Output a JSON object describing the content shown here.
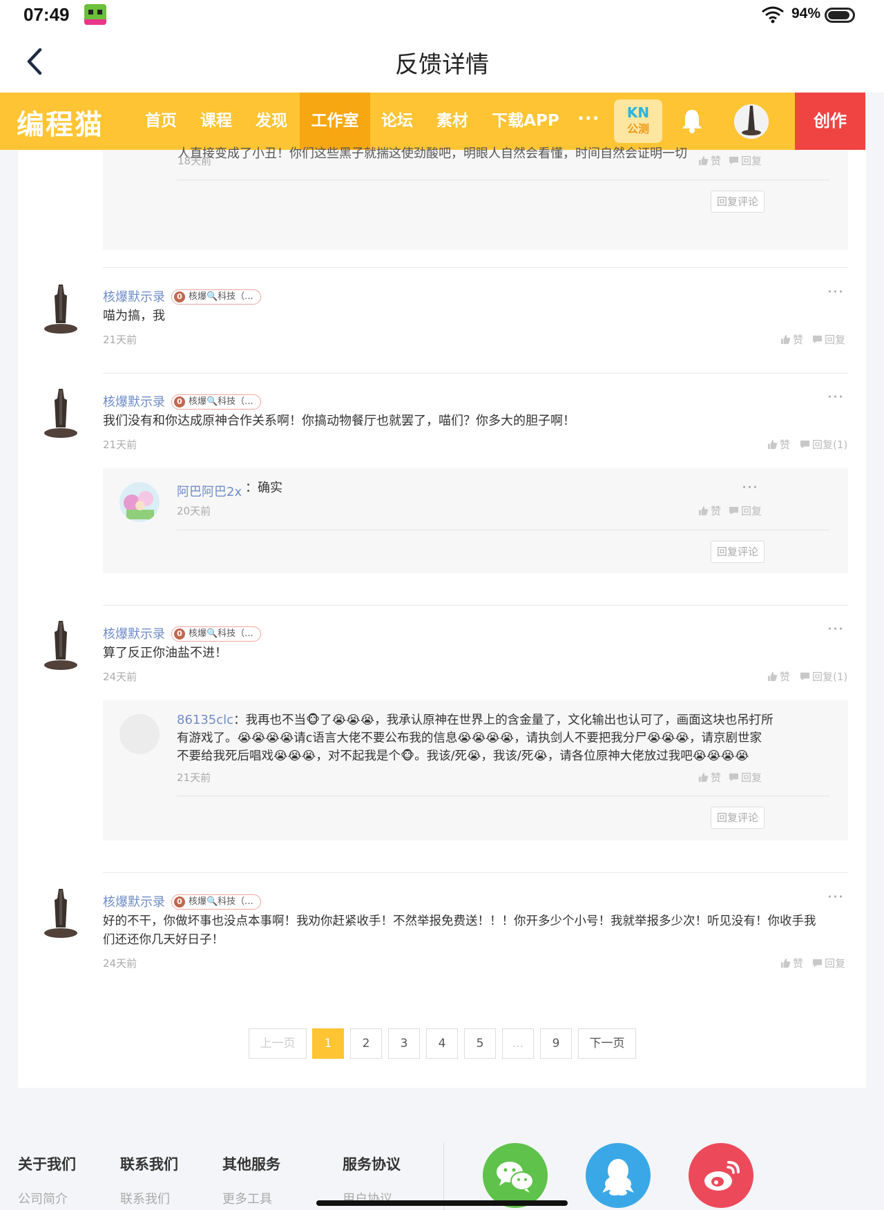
{
  "status_bar": {
    "time": "07:49",
    "battery": "94%"
  },
  "title_bar": {
    "title": "反馈详情"
  },
  "site_nav": {
    "logo": "编程猫",
    "items": [
      "首页",
      "课程",
      "发现",
      "工作室",
      "论坛",
      "素材",
      "下载APP"
    ],
    "active_item": "工作室",
    "more": "···",
    "kn_top": "KN",
    "kn_bottom": "公测",
    "create": "创作"
  },
  "colors": {
    "nav_bg": "#fec433",
    "nav_active": "#f7a712",
    "create_bg": "#ef4442",
    "username": "#6f8cc8"
  },
  "top_partial": {
    "text": "人直接变成了小丑！你们这些黑子就揣这使劲酸吧，明眼人自然会看懂，时间自然会证明一切",
    "time": "18天前",
    "like": "赞",
    "reply": "回复",
    "reply_comment": "回复评论"
  },
  "comments": [
    {
      "user": "核爆默示录",
      "badge": "核爆🔍科技（...",
      "text": "喵为搞，我",
      "time": "21天前",
      "like": "赞",
      "reply": "回复"
    },
    {
      "user": "核爆默示录",
      "badge": "核爆🔍科技（...",
      "text": "我们没有和你达成原神合作关系啊！你搞动物餐厅也就罢了，喵们？你多大的胆子啊！",
      "time": "21天前",
      "like": "赞",
      "reply": "回复(1)",
      "sub_reply": {
        "user": "阿巴阿巴2x",
        "text": "：确实",
        "time": "20天前",
        "like": "赞",
        "reply": "回复",
        "reply_comment": "回复评论"
      }
    },
    {
      "user": "核爆默示录",
      "badge": "核爆🔍科技（...",
      "text": "算了反正你油盐不进！",
      "time": "24天前",
      "like": "赞",
      "reply": "回复(1)",
      "sub_reply": {
        "user": "86135clc",
        "line1": "：我再也不当🐵了😭😭😭，我承认原神在世界上的含金量了，文化输出也认可了，画面这块也吊打所",
        "line2": "有游戏了。😭😭😭😭请c语言大佬不要公布我的信息😭😭😭😭，请执剑人不要把我分尸😭😭😭，请京剧世家",
        "line3": "不要给我死后唱戏😭😭😭，对不起我是个🐵。我该/死😭，我该/死😭，请各位原神大佬放过我吧😭😭😭😭",
        "time": "21天前",
        "like": "赞",
        "reply": "回复",
        "reply_comment": "回复评论"
      }
    },
    {
      "user": "核爆默示录",
      "badge": "核爆🔍科技（...",
      "line1": "好的不干，你做坏事也没点本事啊！我劝你赶紧收手！不然举报免费送！！！你开多少个小号！我就举报多少次！听见没有！你收手我",
      "line2": "们还还你几天好日子！",
      "time": "24天前",
      "like": "赞",
      "reply": "回复"
    }
  ],
  "pagination": {
    "prev": "上一页",
    "pages": [
      "1",
      "2",
      "3",
      "4",
      "5",
      "...",
      "9"
    ],
    "current": "1",
    "next": "下一页"
  },
  "footer": {
    "columns": [
      {
        "head": "关于我们",
        "link": "公司简介"
      },
      {
        "head": "联系我们",
        "link": "联系我们"
      },
      {
        "head": "其他服务",
        "link": "更多工具"
      },
      {
        "head": "服务协议",
        "link": "用户协议"
      }
    ],
    "social": [
      "wechat-icon",
      "qq-icon",
      "weibo-icon"
    ]
  }
}
